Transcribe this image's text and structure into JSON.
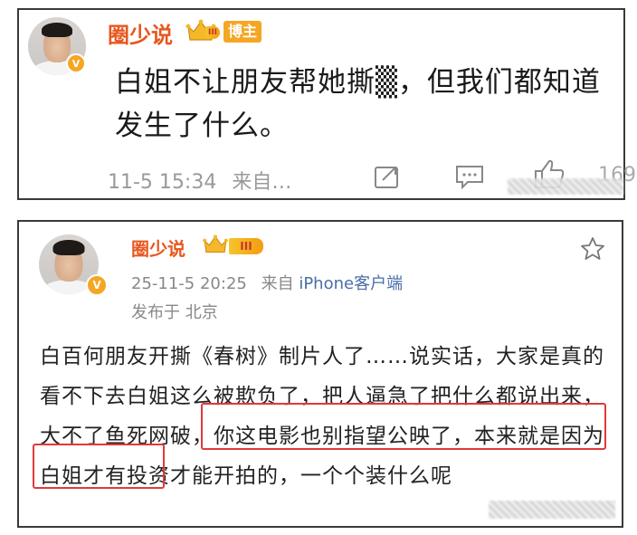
{
  "post1": {
    "author": "圈少说",
    "badge": "博主",
    "level": "III",
    "text": "白姐不让朋友帮她撕▒，但我们都知道发生了什么。",
    "time": "11-5 15:34",
    "source": "来自…",
    "like_count": "169",
    "icons": [
      "share-icon",
      "comment-icon",
      "like-icon"
    ]
  },
  "post2": {
    "author": "圈少说",
    "level": "III",
    "datetime": "25-11-5 20:25",
    "source_prefix": "来自",
    "source": "iPhone客户端",
    "location": "发布于 北京",
    "text": "白百何朋友开撕《春树》制片人了……说实话，大家是真的看不下去白姐这么被欺负了，把人逼急了把什么都说出来，大不了鱼死网破，你这电影也别指望公映了，本来就是因为白姐才有投资才能开拍的，一个个装什么呢",
    "highlights": [
      "大不了鱼死网破，你这电影也别指",
      "望公映了，"
    ]
  },
  "colors": {
    "username": "#e8571e",
    "verified": "#f5a623",
    "highlight_box": "#e03a3a",
    "link": "#4a6fa5"
  }
}
